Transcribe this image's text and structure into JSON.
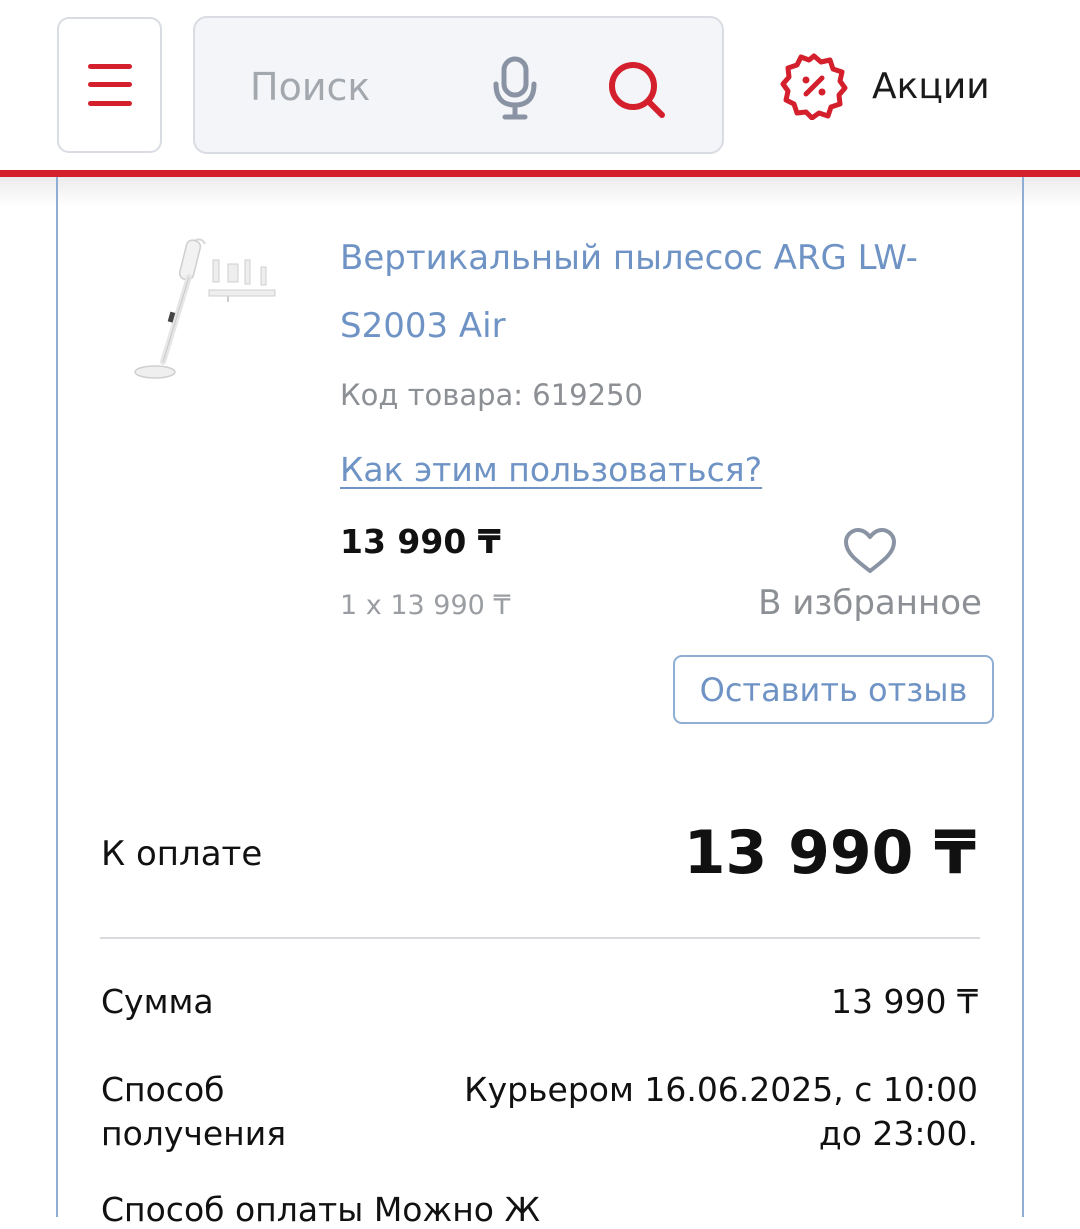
{
  "header": {
    "search_placeholder": "Поиск",
    "promo_label": "Акции",
    "accent_color": "#d4202c"
  },
  "product": {
    "title": "Вертикальный пылесос ARG LW-S2003 Air",
    "code": "Код товара: 619250",
    "howto_link": "Как этим пользоваться?",
    "price": "13 990 ₸",
    "price_calc": "1 x 13 990 ₸",
    "favorite_label": "В избранное",
    "review_button": "Оставить отзыв",
    "link_color": "#6e93c4"
  },
  "summary": {
    "pay_label": "К оплате",
    "pay_value": "13 990 ₸",
    "sum_label": "Сумма",
    "sum_value": "13 990 ₸",
    "delivery_label": "Способ получения",
    "delivery_value": "Курьером 16.06.2025, с 10:00 до 23:00.",
    "next_row_partial": "Способ оплаты                    Можно Ж"
  },
  "icons": {
    "menu": "hamburger-menu-icon",
    "mic": "microphone-icon",
    "search": "search-icon",
    "promo": "discount-badge-icon",
    "favorite": "heart-icon"
  }
}
